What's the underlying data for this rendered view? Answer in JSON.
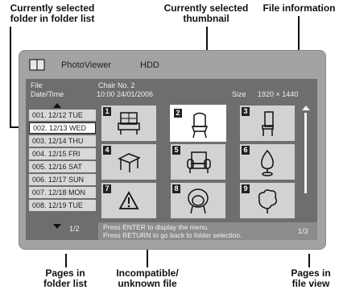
{
  "callouts": {
    "folder_selected": "Currently selected\nfolder in folder list",
    "thumb_selected": "Currently selected\nthumbnail",
    "file_info": "File information",
    "pages_folder": "Pages in\nfolder list",
    "incompatible": "Incompatible/\nunknown file",
    "pages_file": "Pages in\nfile view"
  },
  "app": {
    "title": "PhotoViewer",
    "device": "HDD"
  },
  "info": {
    "file_label": "File",
    "file_value": "Chair No. 2",
    "date_label": "Date/Time",
    "date_value": "10:00  24/01/2006",
    "size_label": "Size",
    "size_value": "1920 × 1440"
  },
  "folders": [
    "001. 12/12 TUE",
    "002. 12/13 WED",
    "003. 12/14 THU",
    "004. 12/15 FRI",
    "005. 12/16 SAT",
    "006. 12/17 SUN",
    "007. 12/18 MON",
    "008. 12/19 TUE"
  ],
  "folder_pages": "1/2",
  "thumbnails": [
    "1",
    "2",
    "3",
    "4",
    "5",
    "6",
    "7",
    "8",
    "9"
  ],
  "message": {
    "line1": "Press ENTER to display the menu.",
    "line2": "Press RETURN to go back to folder selection."
  },
  "file_pages": "1/3"
}
